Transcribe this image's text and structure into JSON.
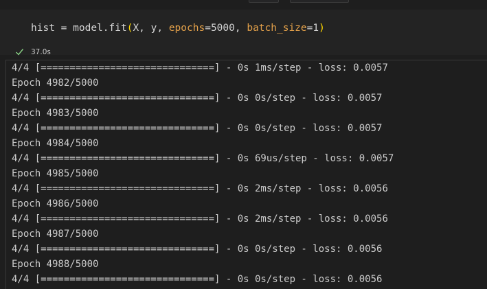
{
  "cell": {
    "code": {
      "var": "hist",
      "assign": " = ",
      "call": "model.fit",
      "open_paren": "(",
      "args_plain": "X, y, ",
      "kw1": "epochs",
      "eq1": "=",
      "val1": "5000",
      "sep": ", ",
      "kw2": "batch_size",
      "eq2": "=",
      "val2": "1",
      "close_paren": ")"
    },
    "status": {
      "icon": "check-icon",
      "time": "37.0s"
    }
  },
  "output": {
    "lines": [
      "4/4 [==============================] - 0s 1ms/step - loss: 0.0057",
      "Epoch 4982/5000",
      "4/4 [==============================] - 0s 0s/step - loss: 0.0057",
      "Epoch 4983/5000",
      "4/4 [==============================] - 0s 0s/step - loss: 0.0057",
      "Epoch 4984/5000",
      "4/4 [==============================] - 0s 69us/step - loss: 0.0057",
      "Epoch 4985/5000",
      "4/4 [==============================] - 0s 2ms/step - loss: 0.0056",
      "Epoch 4986/5000",
      "4/4 [==============================] - 0s 2ms/step - loss: 0.0056",
      "Epoch 4987/5000",
      "4/4 [==============================] - 0s 0s/step - loss: 0.0056",
      "Epoch 4988/5000",
      "4/4 [==============================] - 0s 0s/step - loss: 0.0056"
    ]
  },
  "colors": {
    "background": "#1e1e1e",
    "cell_background": "#232323",
    "check": "#89d185",
    "keyword_arg": "#e2a04a",
    "paren": "#ffd700"
  }
}
